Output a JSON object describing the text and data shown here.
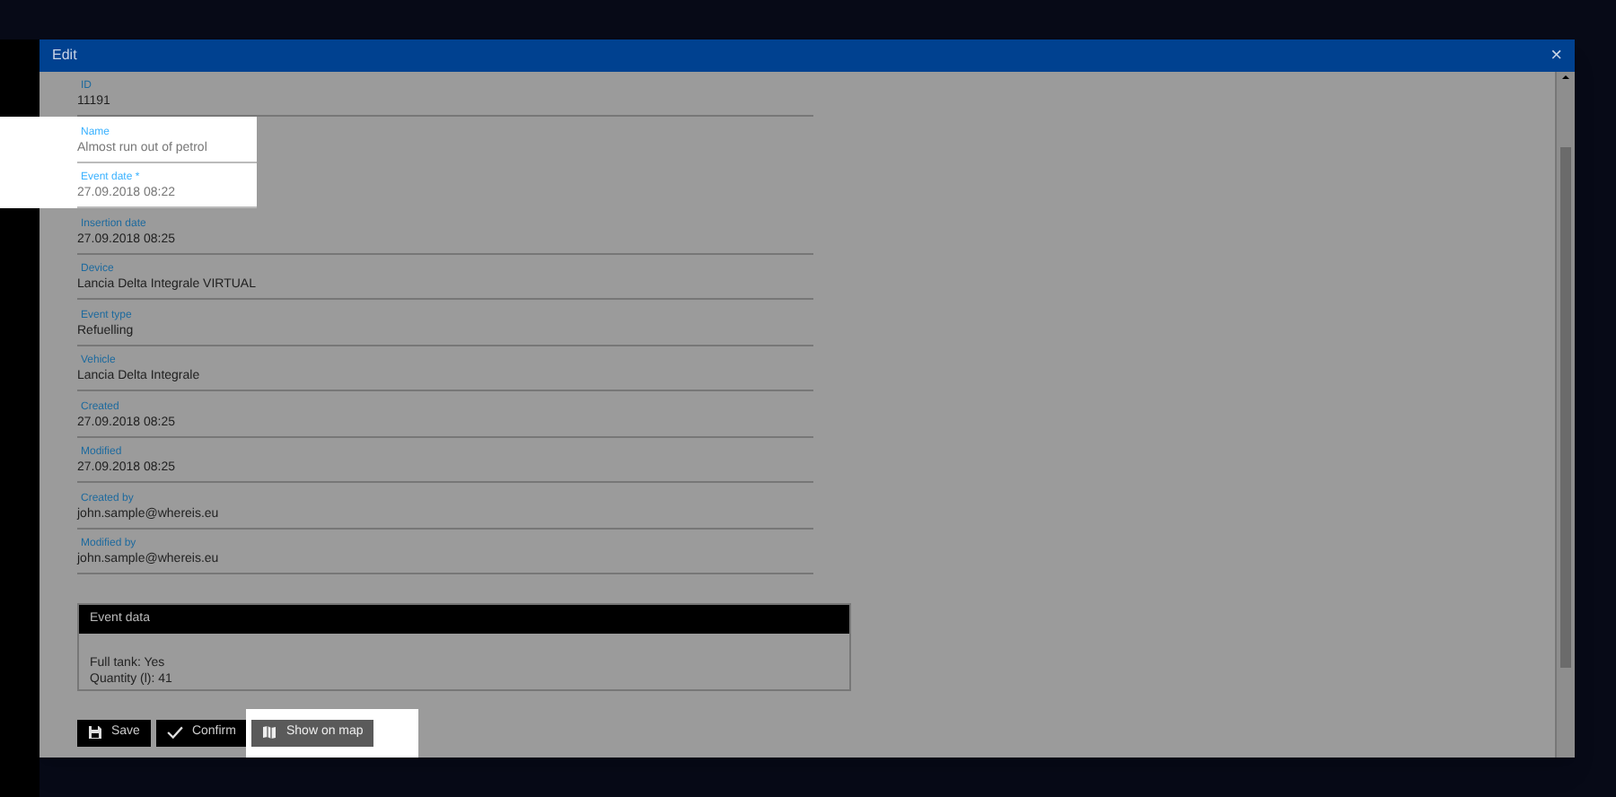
{
  "dialog": {
    "title": "Edit",
    "close": "×"
  },
  "fields": [
    {
      "label": "ID",
      "value": "11191",
      "highlighted": false
    },
    {
      "label": "Name",
      "value": "Almost run out of petrol",
      "highlighted": true
    },
    {
      "label": "Event date *",
      "value": "27.09.2018 08:22",
      "highlighted": true
    },
    {
      "label": "Insertion date",
      "value": "27.09.2018 08:25",
      "highlighted": false
    },
    {
      "label": "Device",
      "value": "Lancia Delta Integrale VIRTUAL",
      "highlighted": false
    },
    {
      "label": "Event type",
      "value": "Refuelling",
      "highlighted": false
    },
    {
      "label": "Vehicle",
      "value": "Lancia Delta Integrale",
      "highlighted": false
    },
    {
      "label": "Created",
      "value": "27.09.2018 08:25",
      "highlighted": false
    },
    {
      "label": "Modified",
      "value": "27.09.2018 08:25",
      "highlighted": false
    },
    {
      "label": "Created by",
      "value": "john.sample@whereis.eu",
      "highlighted": false
    },
    {
      "label": "Modified by",
      "value": "john.sample@whereis.eu",
      "highlighted": false
    }
  ],
  "event_data": {
    "title": "Event data",
    "lines": [
      "Full tank: Yes",
      "Quantity (l): 41"
    ]
  },
  "buttons": [
    {
      "label": "Save",
      "kind": "save",
      "highlighted": false
    },
    {
      "label": "Confirm",
      "kind": "confirm",
      "highlighted": false
    },
    {
      "label": "Show on map",
      "kind": "map",
      "highlighted": true
    }
  ]
}
